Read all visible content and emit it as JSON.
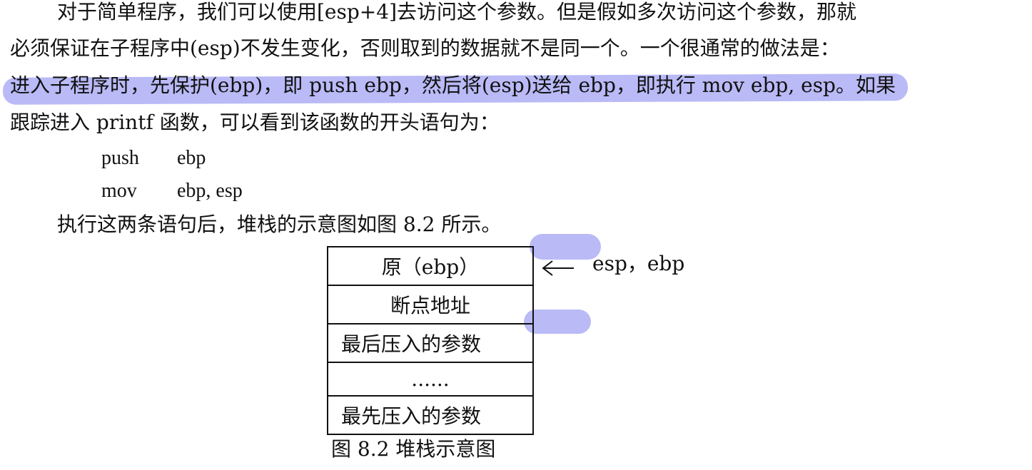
{
  "paragraph": {
    "line1": "对于简单程序，我们可以使用[esp+4]去访问这个参数。但是假如多次访问这个参数，那就",
    "line2": "必须保证在子程序中(esp)不发生变化，否则取到的数据就不是同一个。一个很通常的做法是：",
    "line3": "进入子程序时，先保护(ebp)，即  push ebp，然后将(esp)送给 ebp，即执行  mov ebp, esp。如果",
    "line4": "跟踪进入 printf 函数，可以看到该函数的开头语句为："
  },
  "code": [
    {
      "op": "push",
      "args": "ebp"
    },
    {
      "op": "mov",
      "args": "ebp, esp"
    }
  ],
  "after_code": "执行这两条语句后，堆栈的示意图如图 8.2 所示。",
  "stack": {
    "cells": [
      "原（ebp）",
      "断点地址",
      "最后压入的参数",
      "......",
      "最先压入的参数"
    ],
    "pointer_label": "esp，ebp"
  },
  "figure_caption": "图 8.2  堆栈示意图",
  "colors": {
    "highlight": "#7f82ee"
  }
}
